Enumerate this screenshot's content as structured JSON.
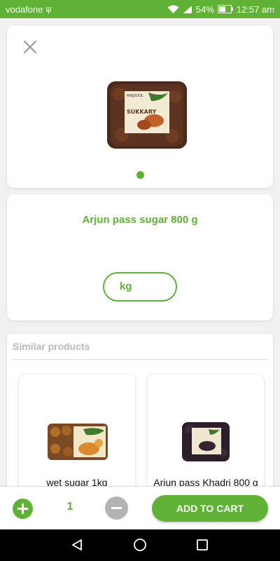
{
  "status_bar": {
    "carrier": "vodafone",
    "battery": "54%",
    "time": "12:57 am",
    "icons": [
      "usb-icon",
      "wifi-icon",
      "signal-icon",
      "battery-icon"
    ]
  },
  "product": {
    "title": "Arjun pass sugar 800 g",
    "unit": "kg",
    "image_label": "SUKKARY",
    "brand_label": "MAJDOOL",
    "gallery_current_page": 1,
    "gallery_total_pages": 1
  },
  "similar": {
    "title": "Similar products",
    "items": [
      {
        "name": "wet sugar 1kg"
      },
      {
        "name": "Arjun pass Khadri 800 g"
      }
    ]
  },
  "cart_bar": {
    "quantity": "1",
    "add_to_cart_label": "ADD TO CART"
  },
  "colors": {
    "accent": "#5fb236",
    "muted": "#b3b3b3"
  }
}
